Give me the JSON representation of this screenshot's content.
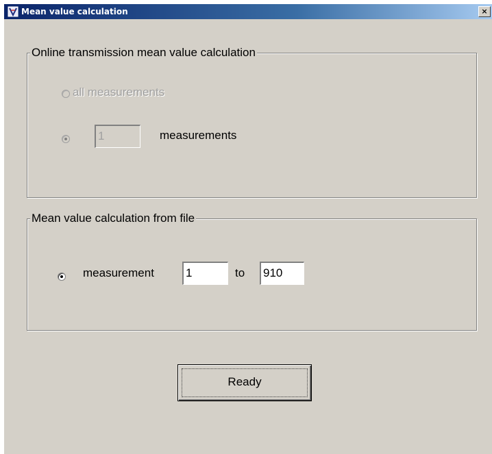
{
  "window": {
    "title": "Mean value calculation",
    "close_label": "×",
    "icon": "app-icon"
  },
  "online_group": {
    "title": "Online transmission mean value calculation",
    "option_all_label": "all measurements",
    "option_all_selected": false,
    "option_all_enabled": false,
    "option_n_selected": true,
    "option_n_enabled": false,
    "count_value": "1",
    "count_suffix": "measurements"
  },
  "file_group": {
    "title": "Mean value calculation from file",
    "option_selected": true,
    "from_label": "measurement",
    "from_value": "1",
    "to_label": "to",
    "to_value": "910"
  },
  "actions": {
    "ready_label": "Ready"
  }
}
